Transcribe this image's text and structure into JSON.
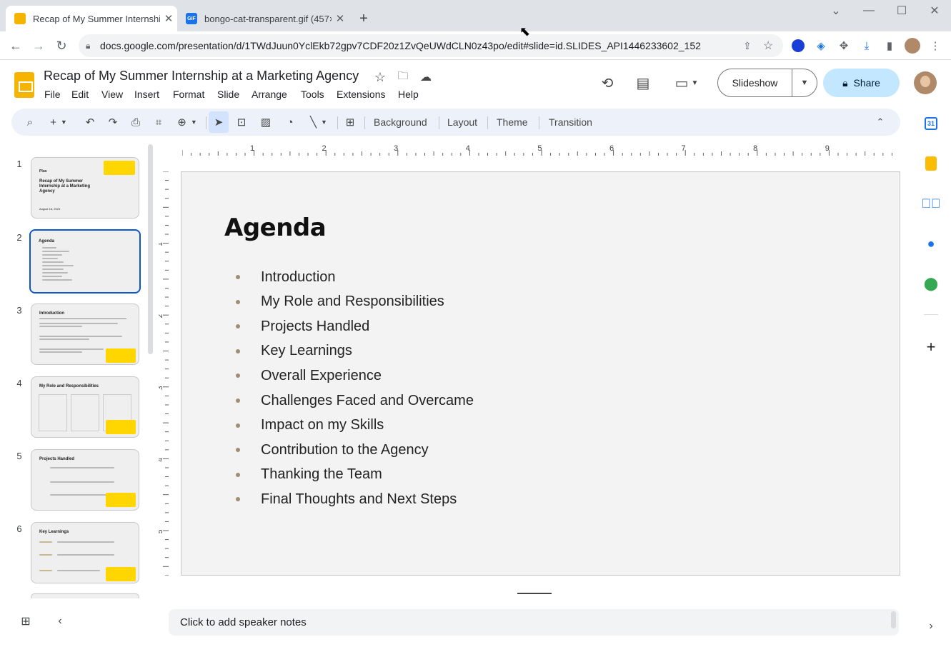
{
  "browser": {
    "tabs": [
      {
        "title": "Recap of My Summer Internship",
        "icon": "slides-icon",
        "close": "✕"
      },
      {
        "title": "bongo-cat-transparent.gif (457×",
        "icon": "gif-icon",
        "close": "✕"
      }
    ],
    "new_tab": "+",
    "url": "docs.google.com/presentation/d/1TWdJuun0YclEkb72gpv7CDF20z1ZvQeUWdCLN0z43po/edit#slide=id.SLIDES_API1446233602_152",
    "gif_badge": "GIF"
  },
  "doc": {
    "title": "Recap of My Summer Internship at a Marketing Agency",
    "menus": [
      "File",
      "Edit",
      "View",
      "Insert",
      "Format",
      "Slide",
      "Arrange",
      "Tools",
      "Extensions",
      "Help"
    ],
    "slideshow_label": "Slideshow",
    "share_label": "Share"
  },
  "toolbar": {
    "background": "Background",
    "layout": "Layout",
    "theme": "Theme",
    "transition": "Transition"
  },
  "ruler": {
    "h_ticks": [
      "1",
      "2",
      "3",
      "4",
      "5",
      "6",
      "7",
      "8",
      "9"
    ],
    "v_ticks": [
      "1",
      "2",
      "3",
      "4",
      "5"
    ]
  },
  "filmstrip": {
    "numbers": [
      "1",
      "2",
      "3",
      "4",
      "5",
      "6"
    ],
    "slide1": {
      "brand": "Plus",
      "title": "Recap of My Summer Internship at a Marketing Agency",
      "date": "August 18, 2023"
    },
    "slide2": {
      "title": "Agenda"
    },
    "slide3": {
      "title": "Introduction"
    },
    "slide4": {
      "title": "My Role and Responsibilities"
    },
    "slide5": {
      "title": "Projects Handled"
    },
    "slide6": {
      "title": "Key Learnings"
    }
  },
  "slide": {
    "title": "Agenda",
    "items": [
      "Introduction",
      "My Role and Responsibilities",
      "Projects Handled",
      "Key Learnings",
      "Overall Experience",
      "Challenges Faced and Overcame",
      "Impact on my Skills",
      "Contribution to the Agency",
      "Thanking the Team",
      "Final Thoughts and Next Steps"
    ]
  },
  "notes": {
    "placeholder": "Click to add speaker notes"
  },
  "colors": {
    "accent": "#0b57d0",
    "share_bg": "#c2e7ff",
    "slides_yellow": "#f4b400",
    "bullet": "#a08d74"
  }
}
